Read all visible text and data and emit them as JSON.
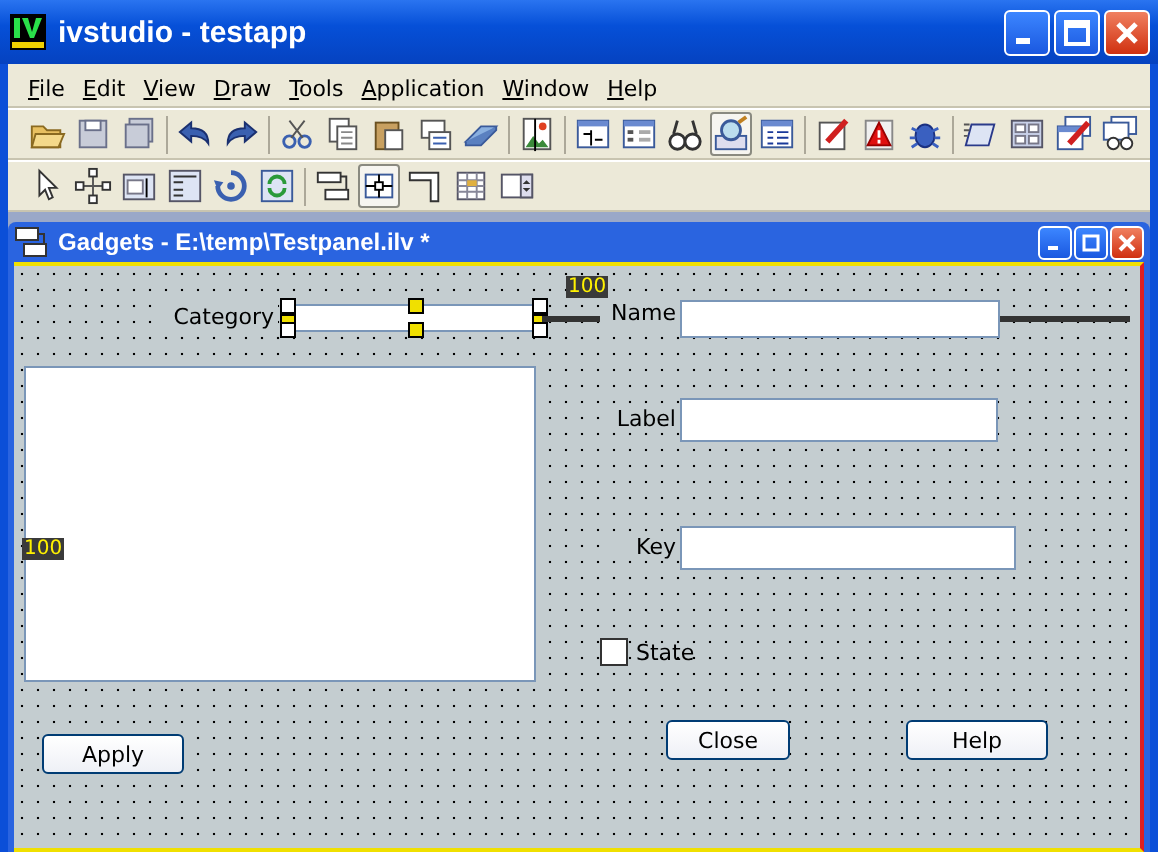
{
  "window": {
    "title": "ivstudio - testapp"
  },
  "menu": [
    {
      "label": "File"
    },
    {
      "label": "Edit"
    },
    {
      "label": "View"
    },
    {
      "label": "Draw"
    },
    {
      "label": "Tools"
    },
    {
      "label": "Application"
    },
    {
      "label": "Window"
    },
    {
      "label": "Help"
    }
  ],
  "toolbars": [
    [
      {
        "kind": "open",
        "pressed": false
      },
      {
        "kind": "save",
        "pressed": false
      },
      {
        "kind": "saveall",
        "pressed": false
      },
      {
        "kind": "sep"
      },
      {
        "kind": "undo",
        "pressed": false
      },
      {
        "kind": "redo",
        "pressed": false
      },
      {
        "kind": "sep"
      },
      {
        "kind": "cut",
        "pressed": false
      },
      {
        "kind": "copy",
        "pressed": false
      },
      {
        "kind": "paste",
        "pressed": false
      },
      {
        "kind": "pastespecial",
        "pressed": false
      },
      {
        "kind": "eraser",
        "pressed": false
      },
      {
        "kind": "sep"
      },
      {
        "kind": "image",
        "pressed": false
      },
      {
        "kind": "sep"
      },
      {
        "kind": "align",
        "pressed": false
      },
      {
        "kind": "form",
        "pressed": false
      },
      {
        "kind": "binoculars",
        "pressed": false
      },
      {
        "kind": "inspector",
        "pressed": true
      },
      {
        "kind": "list",
        "pressed": false
      },
      {
        "kind": "sep"
      },
      {
        "kind": "edit",
        "pressed": false
      },
      {
        "kind": "alert",
        "pressed": false
      },
      {
        "kind": "bug",
        "pressed": false
      },
      {
        "kind": "sep"
      },
      {
        "kind": "notebook",
        "pressed": false
      },
      {
        "kind": "grid",
        "pressed": false
      },
      {
        "kind": "editpanels",
        "pressed": false
      },
      {
        "kind": "findpanels",
        "pressed": false
      }
    ],
    [
      {
        "kind": "pointer",
        "pressed": false
      },
      {
        "kind": "nodes",
        "pressed": false
      },
      {
        "kind": "label",
        "pressed": false
      },
      {
        "kind": "multilabel",
        "pressed": false
      },
      {
        "kind": "rotate",
        "pressed": false
      },
      {
        "kind": "refresh",
        "pressed": false
      },
      {
        "kind": "sep"
      },
      {
        "kind": "dock",
        "pressed": false
      },
      {
        "kind": "attach",
        "pressed": true
      },
      {
        "kind": "corner",
        "pressed": false
      },
      {
        "kind": "table",
        "pressed": false
      },
      {
        "kind": "spinner",
        "pressed": false
      }
    ]
  ],
  "child_window": {
    "title": "Gadgets - E:\\temp\\Testpanel.ilv *"
  },
  "gadgets": [
    {
      "kind": "label",
      "text": "Category"
    },
    {
      "kind": "field",
      "selected": true
    },
    {
      "kind": "guide",
      "text": "100"
    },
    {
      "kind": "link"
    },
    {
      "kind": "label",
      "text": "Name"
    },
    {
      "kind": "field",
      "selected": false
    },
    {
      "kind": "list",
      "selected": false
    },
    {
      "kind": "guide",
      "text": "100"
    },
    {
      "kind": "label",
      "text": "Label"
    },
    {
      "kind": "field",
      "selected": false
    },
    {
      "kind": "label",
      "text": "Key"
    },
    {
      "kind": "field",
      "selected": false
    },
    {
      "kind": "checkbox",
      "text": "State",
      "checked": false
    },
    {
      "kind": "button",
      "text": "Apply"
    },
    {
      "kind": "button",
      "text": "Close"
    },
    {
      "kind": "button",
      "text": "Help"
    }
  ]
}
